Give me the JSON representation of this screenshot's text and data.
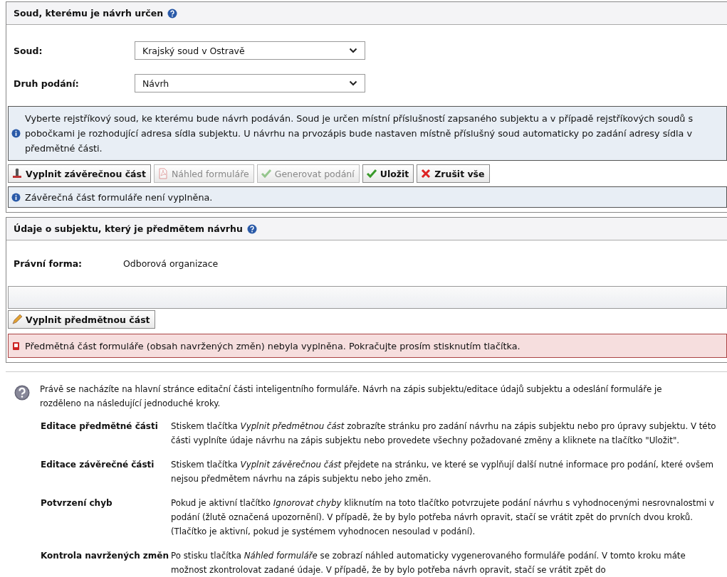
{
  "court_panel": {
    "title": "Soud, kterému je návrh určen",
    "fields": [
      {
        "label": "Soud:",
        "value": "Krajský soud v Ostravě"
      },
      {
        "label": "Druh podání:",
        "value": "Návrh"
      }
    ],
    "info": "Vyberte rejstříkový soud, ke kterému bude návrh podáván. Soud je určen místní příslušností zapsaného subjektu a v případě rejstříkových soudů s pobočkami je rozhodující adresa sídla subjektu. U návrhu na prvozápis bude nastaven místně příslušný soud automaticky po zadání adresy sídla v předmětné části.",
    "buttons": [
      {
        "label": "Vyplnit závěrečnou část",
        "disabled": false
      },
      {
        "label": "Náhled formuláře",
        "disabled": true
      },
      {
        "label": "Generovat podání",
        "disabled": true
      },
      {
        "label": "Uložit",
        "disabled": false
      },
      {
        "label": "Zrušit vše",
        "disabled": false
      }
    ],
    "status": "Závěrečná část formuláře není vyplněna."
  },
  "subject_panel": {
    "title": "Údaje o subjektu, který je předmětem návrhu",
    "field": {
      "label": "Právní forma:",
      "value": "Odborová organizace"
    },
    "button": {
      "label": "Vyplnit předmětnou část"
    },
    "error": "Předmětná část formuláře (obsah navržených změn) nebyla vyplněna. Pokračujte prosím stisknutím tlačítka."
  },
  "help": {
    "intro": "Právě se nacházíte na hlavní stránce editační části inteligentního formuláře. Návrh na zápis subjektu/editace údajů subjektu a odeslání formuláře je rozděleno na následující jednoduché kroky.",
    "steps": [
      {
        "term": "Editace předmětné části",
        "description": "Stiskem tlačítka *Vyplnit předmětnou část* zobrazíte stránku pro zadání návrhu na zápis subjektu nebo pro úpravy subjektu. V této části vyplníte údaje návrhu na zápis subjektu nebo provedete všechny požadované změny a kliknete na tlačítko \"Uložit\"."
      },
      {
        "term": "Editace závěrečné části",
        "description": "Stiskem tlačítka *Vyplnit závěrečnou část* přejdete na stránku, ve které se vyplňují další nutné informace pro podání, které ovšem nejsou předmětem návrhu na zápis subjektu nebo jeho změn."
      },
      {
        "term": "Potvrzení chyb",
        "description": "Pokud je aktivní tlačítko *Ignorovat chyby* kliknutím na toto tlačítko potvrzujete podání návrhu s vyhodnocenými nesrovnalostmi v podání (žlutě označená upozornění). V případě, že by bylo potřeba návrh opravit, stačí se vrátit zpět do prvních dvou kroků. (Tlačítko je aktivní, pokud je systémem vyhodnocen nesoulad v podání)."
      },
      {
        "term": "Kontrola navržených změn",
        "description": "Po stisku tlačítka *Náhled formuláře* se zobrazí náhled automaticky vygenerovaného formuláře podání. V tomto kroku máte možnost zkontrolovat zadané údaje. V případě, že by bylo potřeba návrh opravit, stačí se vrátit zpět do"
      }
    ]
  }
}
